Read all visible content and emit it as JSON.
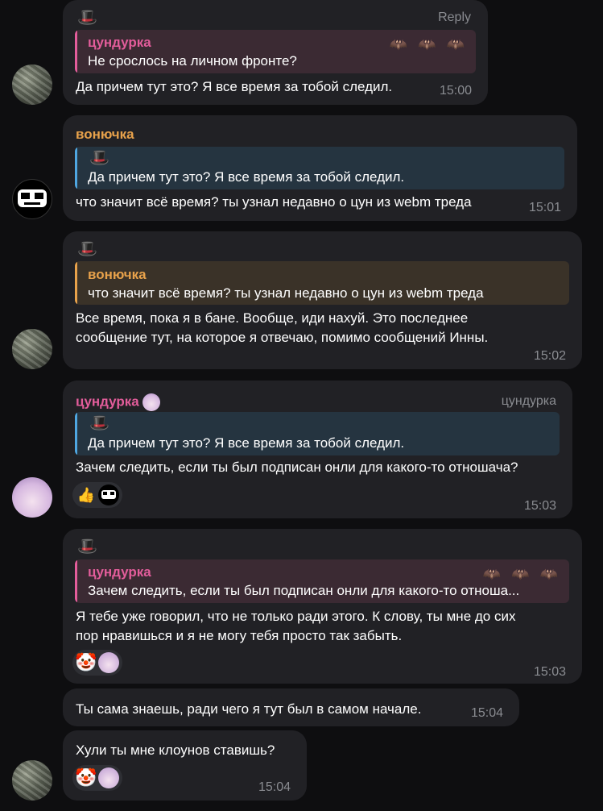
{
  "colors": {
    "pink": "#e35d9b",
    "orange": "#e8a24b",
    "blue": "#4fa6e0",
    "bubble": "#212125"
  },
  "messages": [
    {
      "hat": "🎩",
      "reply_link": "Reply",
      "quote": {
        "name": "цундурка",
        "text": "Не срослось на личном фронте?"
      },
      "text": "Да причем тут это? Я все время за тобой следил.",
      "time": "15:00"
    },
    {
      "sender": "вонючка",
      "quote": {
        "hat": "🎩",
        "text": "Да причем тут это? Я все время за тобой следил."
      },
      "text": "что значит всё время? ты узнал недавно о цун из webm треда",
      "time": "15:01"
    },
    {
      "hat": "🎩",
      "quote": {
        "name": "вонючка",
        "text": "что значит всё время? ты узнал недавно о цун из webm треда"
      },
      "text_lines": [
        "Все время, пока я в бане. Вообще, иди нахуй. Это последнее",
        "сообщение тут, на которое я отвечаю, помимо сообщений Инны."
      ],
      "time": "15:02"
    },
    {
      "sender": "цундурка",
      "sender_right": "цундурка",
      "quote": {
        "hat": "🎩",
        "text": "Да причем тут это? Я все время за тобой следил."
      },
      "text": "Зачем следить, если ты был подписан онли для какого-то отношача?",
      "reactions": [
        "👍",
        "😈"
      ],
      "time": "15:03"
    },
    {
      "hat": "🎩",
      "quote": {
        "name": "цундурка",
        "text": "Зачем следить, если ты был подписан онли для какого-то отноша..."
      },
      "text_lines": [
        "Я тебе уже говорил, что не только ради этого. К слову, ты мне до сих",
        "пор нравишься и я не могу тебя просто так забыть."
      ],
      "reactions": [
        "🤡",
        "anime-avatar"
      ],
      "time": "15:03"
    },
    {
      "text": "Ты сама знаешь, ради чего я тут был в самом начале.",
      "time": "15:04"
    },
    {
      "text": "Хули ты мне клоунов ставишь?",
      "reactions": [
        "🤡",
        "anime-avatar"
      ],
      "time": "15:04"
    }
  ],
  "bats": "🦇 🦇 🦇"
}
